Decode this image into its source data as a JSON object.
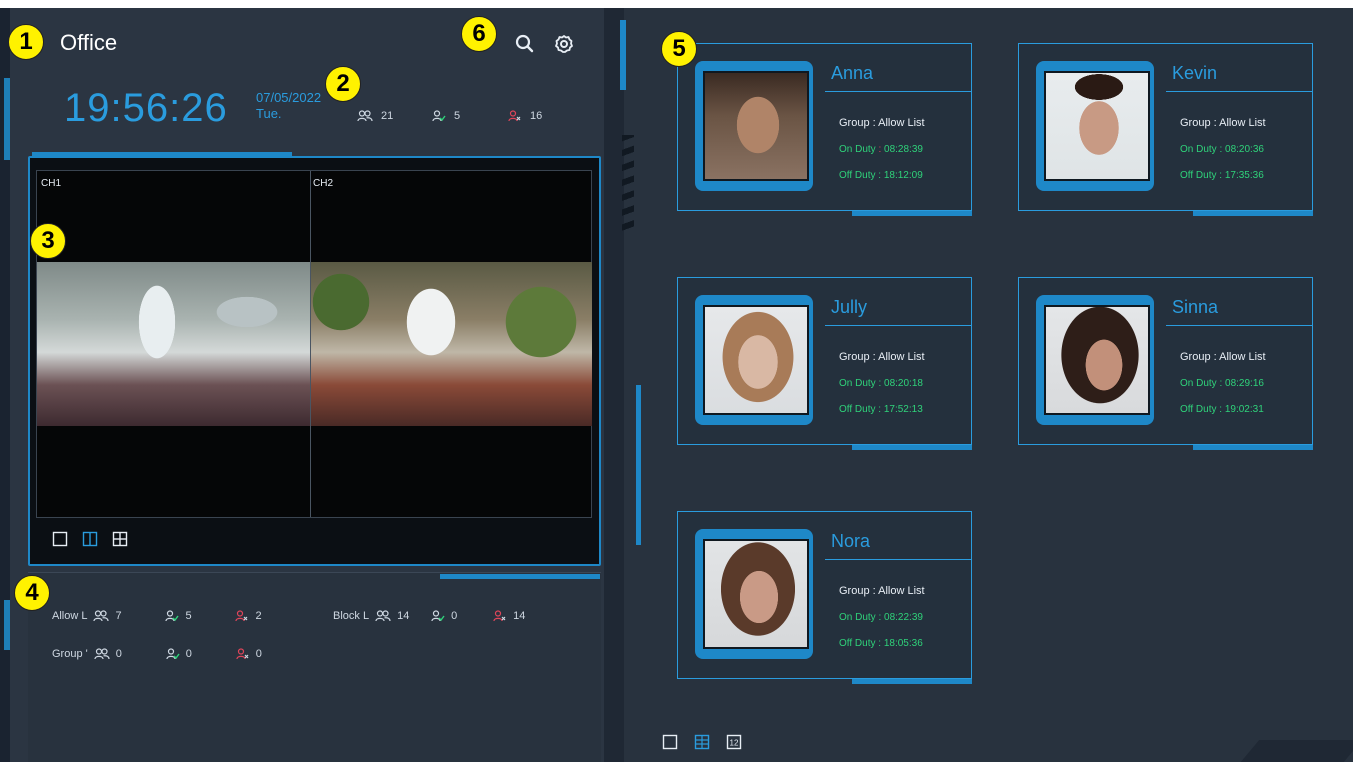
{
  "header": {
    "title": "Office",
    "time": "19:56:26",
    "date": "07/05/2022",
    "weekday": "Tue.",
    "stats": [
      {
        "icon": "people-icon",
        "value": "21",
        "color": "#cfd8e2"
      },
      {
        "icon": "person-allow-icon",
        "value": "5",
        "color": "#2fd27a"
      },
      {
        "icon": "person-block-icon",
        "value": "16",
        "color": "#e0455a"
      }
    ]
  },
  "toolbar": {
    "search_icon": "search-icon",
    "settings_icon": "gear-icon"
  },
  "video": {
    "channels": [
      "CH1",
      "CH2"
    ],
    "layouts": [
      "single-view-icon",
      "dual-view-icon",
      "quad-view-icon"
    ],
    "active_layout": 1
  },
  "lists": {
    "allow": {
      "label": "Allow L",
      "total": "7",
      "allow": "5",
      "block": "2"
    },
    "block": {
      "label": "Block L",
      "total": "14",
      "allow": "0",
      "block": "14"
    },
    "group": {
      "label": "Group '",
      "total": "0",
      "allow": "0",
      "block": "0"
    }
  },
  "people": [
    {
      "name": "Anna",
      "group": "Group  : Allow List",
      "on_duty_label": "On Duty",
      "on_duty": "08:28:39",
      "off_duty_label": "Off Duty",
      "off_duty": "18:12:09",
      "sep_color": "#e0455a",
      "skin": "#b08468"
    },
    {
      "name": "Kevin",
      "group": "Group  : Allow List",
      "on_duty_label": "On Duty",
      "on_duty": "08:20:36",
      "off_duty_label": "Off Duty",
      "off_duty": "17:35:36",
      "sep_color": "#2fd27a",
      "skin": "#c89a84"
    },
    {
      "name": "Jully",
      "group": "Group  : Allow List",
      "on_duty_label": "On Duty",
      "on_duty": "08:20:18",
      "off_duty_label": "Off Duty",
      "off_duty": "17:52:13",
      "sep_color": "#2fd27a",
      "skin": "#d9b8a4"
    },
    {
      "name": "Sinna",
      "group": "Group  : Allow List",
      "on_duty_label": "On Duty",
      "on_duty": "08:29:16",
      "off_duty_label": "Off Duty",
      "off_duty": "19:02:31",
      "sep_color": "#2fd27a",
      "skin": "#c2907a"
    },
    {
      "name": "Nora",
      "group": "Group  : Allow List",
      "on_duty_label": "On Duty",
      "on_duty": "08:22:39",
      "off_duty_label": "Off Duty",
      "off_duty": "18:05:36",
      "sep_color": "#2fd27a",
      "skin": "#c99a86"
    }
  ],
  "bottom_layouts": {
    "icons": [
      "single-view-icon",
      "grid-view-icon",
      "twelve-view-icon"
    ],
    "twelve_label": "12",
    "active": 1
  },
  "callouts": [
    "1",
    "2",
    "3",
    "4",
    "5",
    "6"
  ],
  "colors": {
    "accent": "#1e88c8",
    "allow": "#2fd27a",
    "block": "#e0455a",
    "text": "#e8eef5"
  }
}
